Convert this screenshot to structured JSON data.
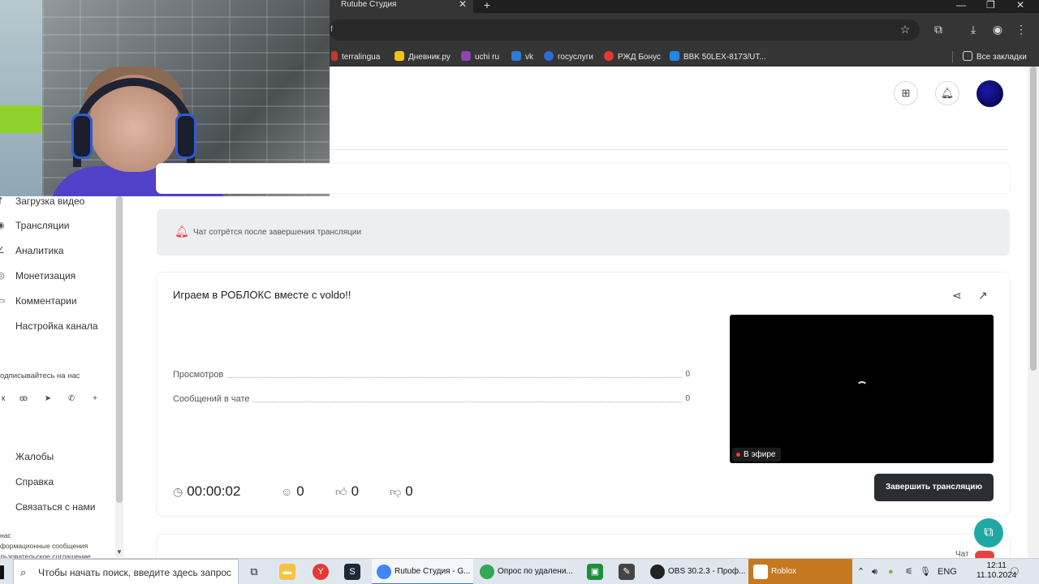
{
  "browser": {
    "tab_title": "Rutube Студия",
    "tab_close": "✕",
    "new_tab": "+",
    "url_fragment": "f",
    "bookmarks": [
      {
        "label": "terralingua",
        "color": "#c0392b"
      },
      {
        "label": "Дневник.ру",
        "color": "#f1c40f"
      },
      {
        "label": "uchi ru",
        "color": "#8e44ad"
      },
      {
        "label": "vk",
        "color": "#2e7bd6"
      },
      {
        "label": "госуслуги",
        "color": "#2c6cd6"
      },
      {
        "label": "РЖД Бонус",
        "color": "#e53935"
      },
      {
        "label": "BBK 50LEX-8173/UT...",
        "color": "#1e88e5"
      }
    ],
    "all_bookmarks": "Все закладки"
  },
  "sidebar": {
    "items": [
      {
        "label": "Загрузка видео",
        "icon": "upload-icon"
      },
      {
        "label": "Трансляции",
        "icon": "broadcast-icon"
      },
      {
        "label": "Аналитика",
        "icon": "analytics-icon"
      },
      {
        "label": "Монетизация",
        "icon": "money-icon"
      },
      {
        "label": "Комментарии",
        "icon": "comments-icon"
      },
      {
        "label": "Настройка канала",
        "icon": "settings-icon"
      }
    ],
    "social_title": "одписывайтесь на нас",
    "social_icons": [
      "vk-icon",
      "ok-icon",
      "telegram-icon",
      "viber-icon",
      "plus-icon"
    ],
    "bottom_items": [
      {
        "label": "Жалобы"
      },
      {
        "label": "Справка"
      },
      {
        "label": "Связаться с нами"
      }
    ],
    "footer_links": [
      "нас",
      "формационные сообщения",
      "льзовательское соглашение"
    ]
  },
  "notice": {
    "text": "Чат сотрётся после завершения трансляции"
  },
  "stream": {
    "title": "Играем в РОБЛОКС вместе с voldo!!",
    "stats": [
      {
        "label": "Просмотров",
        "value": "0"
      },
      {
        "label": "Сообщений в чате",
        "value": "0"
      }
    ],
    "live_badge": "В эфире",
    "duration": "00:00:02",
    "viewers": "0",
    "likes": "0",
    "dislikes": "0",
    "end_button": "Завершить трансляцию"
  },
  "chat": {
    "label": "Чат"
  },
  "taskbar": {
    "search_placeholder": "Чтобы начать поиск, введите здесь запрос",
    "apps": [
      {
        "label": "Rutube Студия - G..."
      },
      {
        "label": "Опрос по удалени..."
      },
      {
        "label": "OBS 30.2.3 - Проф..."
      },
      {
        "label": "Roblox"
      }
    ],
    "lang": "ENG",
    "time": "12:11",
    "date": "11.10.2024"
  },
  "colors": {
    "accent_red": "#e8413e",
    "end_button_bg": "#2a2d32",
    "fab_teal": "#1fa7a4"
  }
}
